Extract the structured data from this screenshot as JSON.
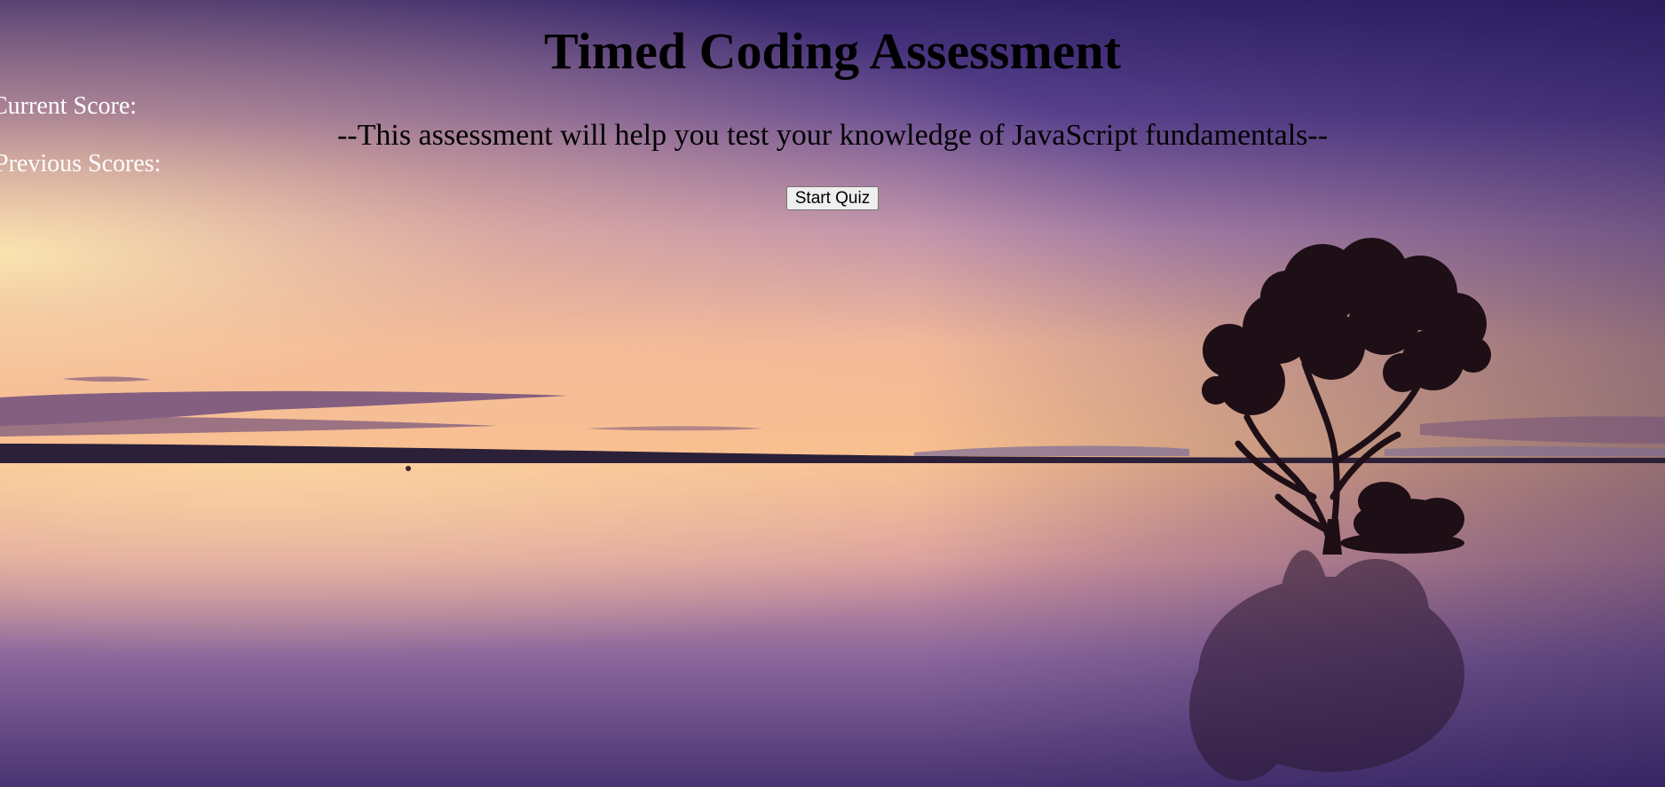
{
  "header": {
    "title": "Timed Coding Assessment",
    "subtitle": "--This assessment will help you test your knowledge of JavaScript fundamentals--"
  },
  "scores": {
    "current_label": "Current Score:",
    "previous_label": "Previous Scores:"
  },
  "actions": {
    "start_label": "Start Quiz"
  },
  "colors": {
    "sky_top": "#3a2a6e",
    "sky_glow": "#f9c98e",
    "water_bottom": "#4a3270",
    "score_text": "#ffffff",
    "heading_text": "#000000"
  }
}
